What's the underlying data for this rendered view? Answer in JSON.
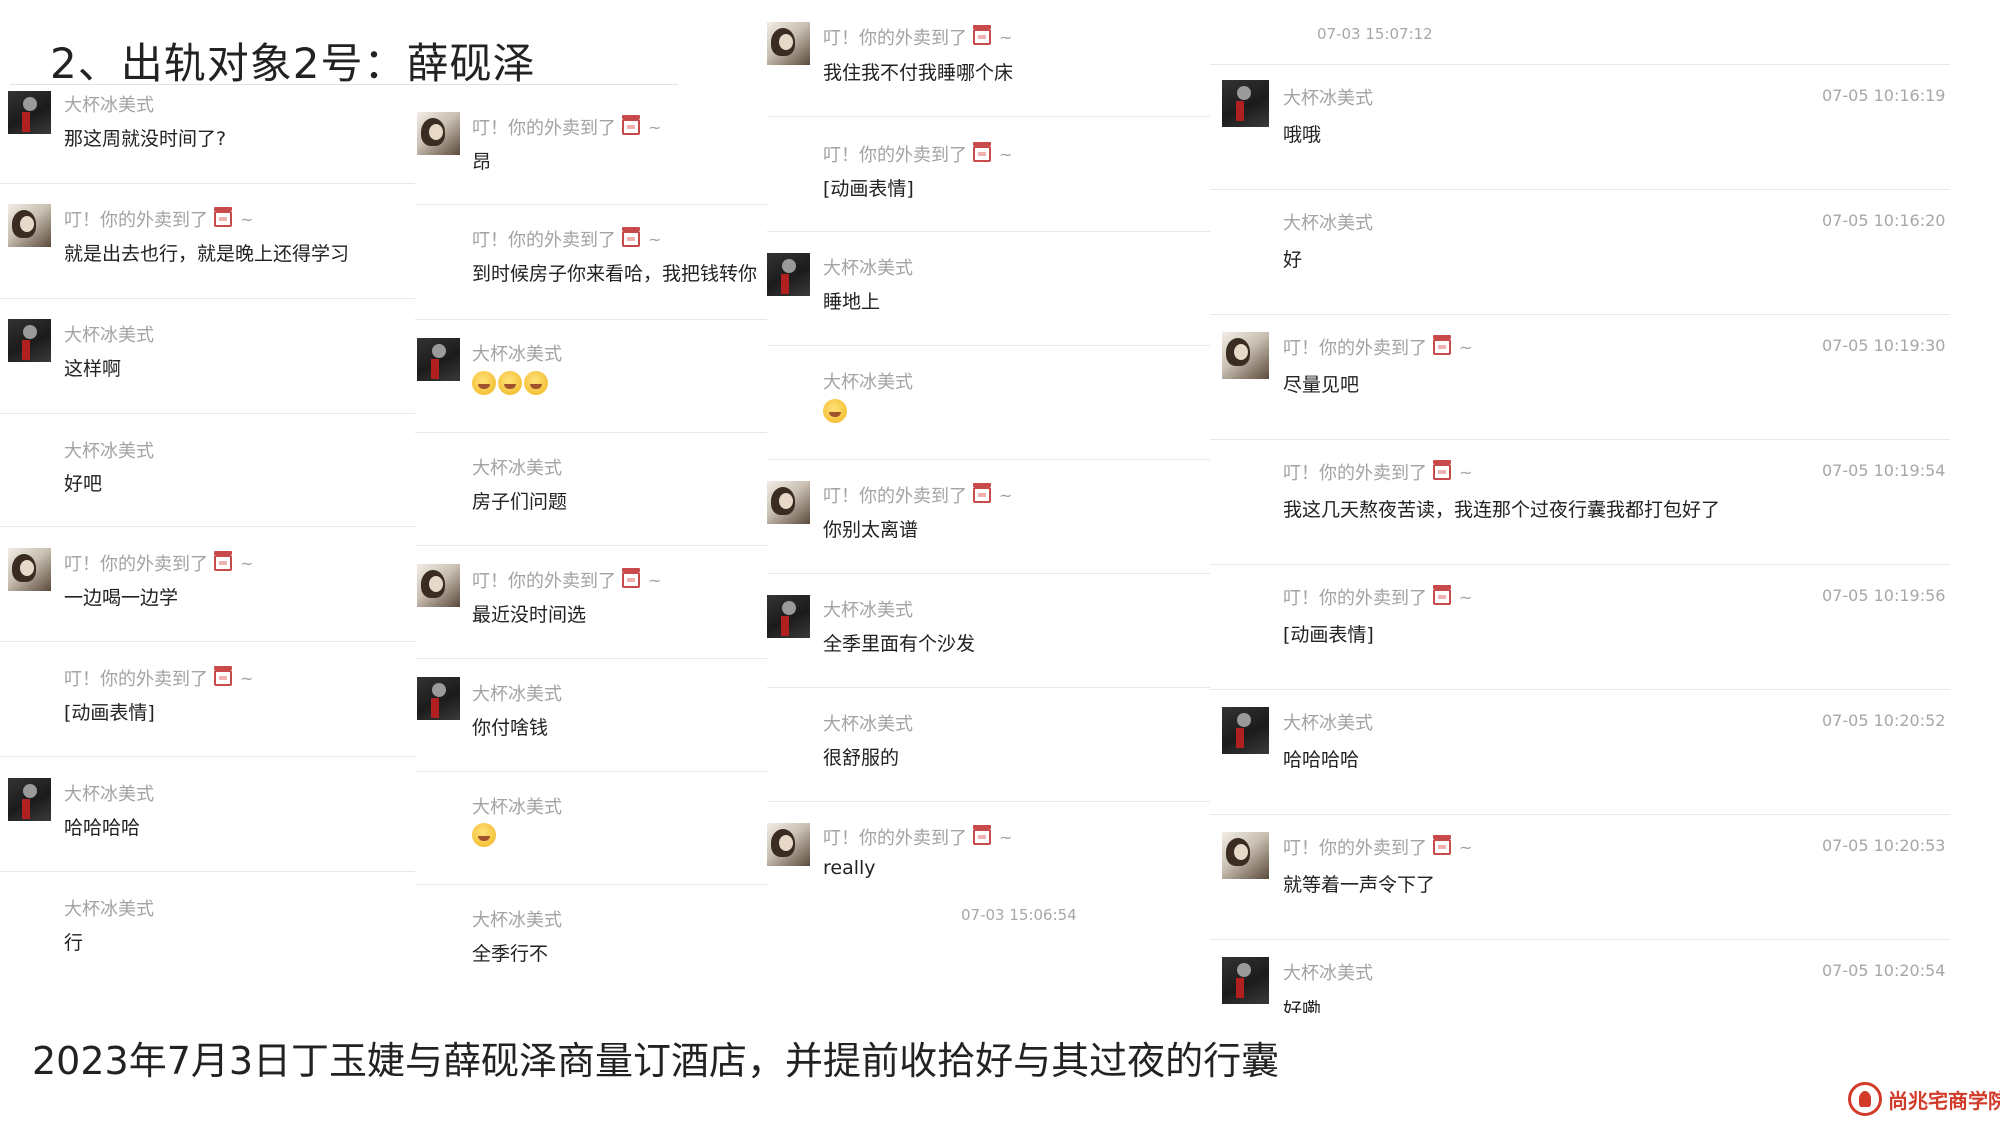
{
  "slide": {
    "title": "2、出轨对象2号：薛砚泽",
    "caption": "2023年7月3日丁玉婕与薛砚泽商量订酒店，并提前收拾好与其过夜的行囊",
    "logo_text": "尚兆宅商学院"
  },
  "column1": {
    "messages": [
      {
        "sender": "大杯冰美式",
        "text": "那这周就没时间了?"
      },
      {
        "sender": "叮！你的外卖到了",
        "text": "就是出去也行，就是晚上还得学习"
      },
      {
        "sender": "大杯冰美式",
        "text": "这样啊"
      },
      {
        "sender": "大杯冰美式",
        "text": "好吧"
      },
      {
        "sender": "叮！你的外卖到了",
        "text": "一边喝一边学"
      },
      {
        "sender": "叮！你的外卖到了",
        "text": "[动画表情]"
      },
      {
        "sender": "大杯冰美式",
        "text": "哈哈哈哈"
      },
      {
        "sender": "大杯冰美式",
        "text": "行"
      }
    ]
  },
  "column2": {
    "messages": [
      {
        "sender": "叮！你的外卖到了",
        "text": "昂"
      },
      {
        "sender": "叮！你的外卖到了",
        "text": "到时候房子你来看哈，我把钱转你"
      },
      {
        "sender": "大杯冰美式",
        "text": ""
      },
      {
        "sender": "大杯冰美式",
        "text": "房子们问题"
      },
      {
        "sender": "叮！你的外卖到了",
        "text": "最近没时间选"
      },
      {
        "sender": "大杯冰美式",
        "text": "你付啥钱"
      },
      {
        "sender": "大杯冰美式",
        "text": ""
      },
      {
        "sender": "大杯冰美式",
        "text": "全季行不"
      }
    ]
  },
  "column3": {
    "messages": [
      {
        "sender": "叮！你的外卖到了",
        "text": "我住我不付我睡哪个床"
      },
      {
        "sender": "叮！你的外卖到了",
        "text": "[动画表情]"
      },
      {
        "sender": "大杯冰美式",
        "text": "睡地上"
      },
      {
        "sender": "大杯冰美式",
        "text": ""
      },
      {
        "sender": "叮！你的外卖到了",
        "text": "你别太离谱"
      },
      {
        "sender": "大杯冰美式",
        "text": "全季里面有个沙发"
      },
      {
        "sender": "大杯冰美式",
        "text": "很舒服的"
      },
      {
        "sender": "叮！你的外卖到了",
        "text": "really"
      }
    ],
    "timestamp_bottom": "07-03 15:06:54"
  },
  "column4": {
    "timestamp_top": "07-03 15:07:12",
    "messages": [
      {
        "sender": "大杯冰美式",
        "text": "哦哦",
        "time": "07-05 10:16:19"
      },
      {
        "sender": "大杯冰美式",
        "text": "好",
        "time": "07-05 10:16:20"
      },
      {
        "sender": "叮！你的外卖到了",
        "text": "尽量见吧",
        "time": "07-05 10:19:30"
      },
      {
        "sender": "叮！你的外卖到了",
        "text": "我这几天熬夜苦读，我连那个过夜行囊我都打包好了",
        "time": "07-05 10:19:54"
      },
      {
        "sender": "叮！你的外卖到了",
        "text": "[动画表情]",
        "time": "07-05 10:19:56"
      },
      {
        "sender": "大杯冰美式",
        "text": "哈哈哈哈",
        "time": "07-05 10:20:52"
      },
      {
        "sender": "叮！你的外卖到了",
        "text": "就等着一声令下了",
        "time": "07-05 10:20:53"
      },
      {
        "sender": "大杯冰美式",
        "text": "好嘞",
        "time": "07-05 10:20:54"
      }
    ]
  },
  "icons": {
    "gift": "takeout-box-icon",
    "emoji": "face-emoji-icon",
    "logo": "school-logo-icon"
  }
}
